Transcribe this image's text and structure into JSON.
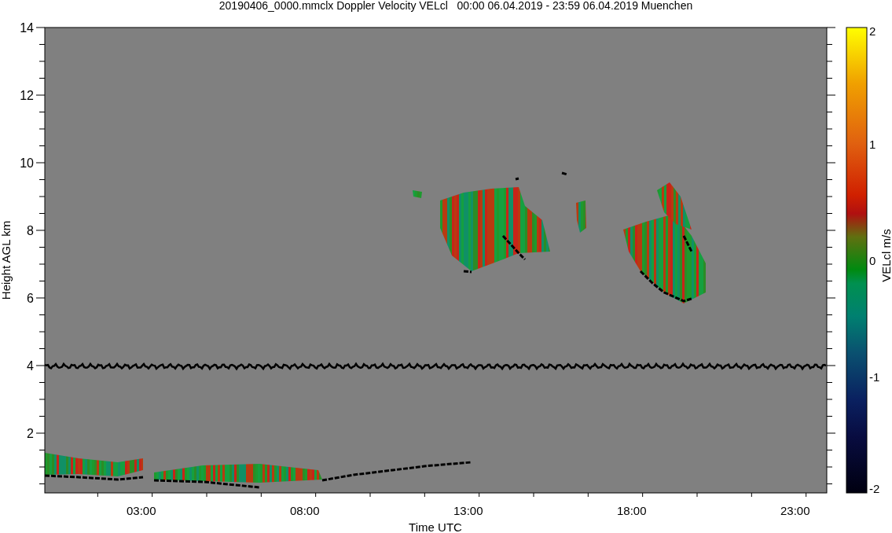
{
  "title": "20190406_0000.mmclx Doppler Velocity VELcl   00:00 06.04.2019 - 23:59 06.04.2019 Muenchen",
  "y_axis": {
    "label": "Height AGL km",
    "ticks": [
      "14",
      "12",
      "10",
      "8",
      "6",
      "4",
      "2"
    ]
  },
  "x_axis": {
    "label": "Time UTC",
    "ticks": [
      "03:00",
      "08:00",
      "13:00",
      "18:00",
      "23:00"
    ]
  },
  "colorbar": {
    "label": "VELcl m/s",
    "ticks": [
      "2",
      "1",
      "0",
      "-1",
      "-2"
    ]
  }
}
